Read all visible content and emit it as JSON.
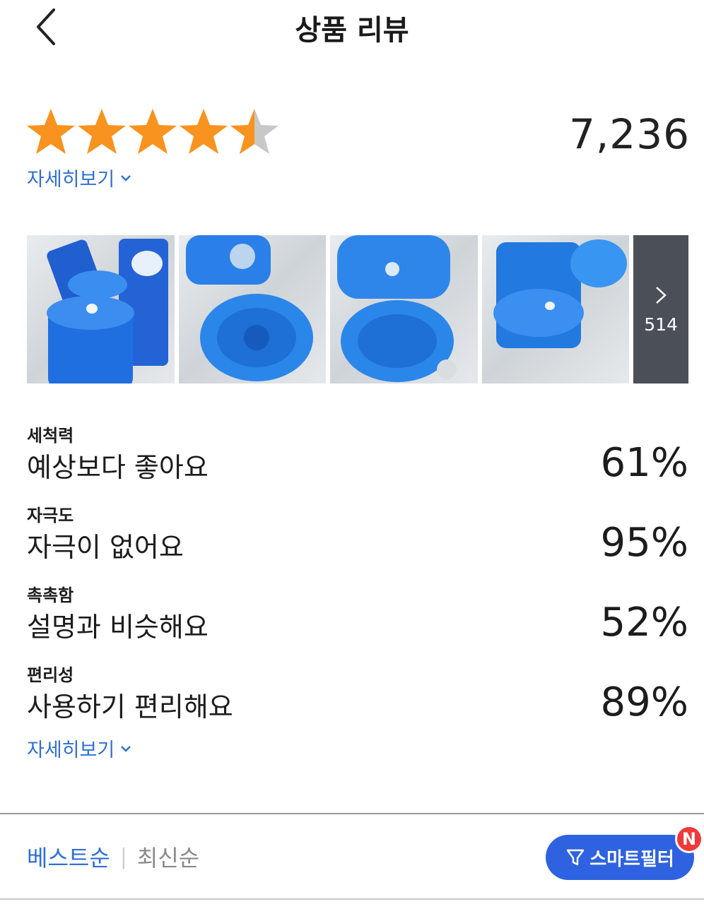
{
  "header": {
    "title": "상품 리뷰"
  },
  "rating": {
    "value": 4.5,
    "max": 5,
    "review_count": "7,236",
    "star_color": "#f7931e",
    "empty_color": "#c8c8c8"
  },
  "detail_link_label": "자세히보기",
  "photos": {
    "more_count": "514"
  },
  "attributes": [
    {
      "category": "세척력",
      "value": "예상보다 좋아요",
      "percent": "61%"
    },
    {
      "category": "자극도",
      "value": "자극이 없어요",
      "percent": "95%"
    },
    {
      "category": "촉촉함",
      "value": "설명과 비슷해요",
      "percent": "52%"
    },
    {
      "category": "편리성",
      "value": "사용하기 편리해요",
      "percent": "89%"
    }
  ],
  "sort": {
    "active": "베스트순",
    "other": "최신순"
  },
  "smart_filter": {
    "label": "스마트필터",
    "badge": "N"
  },
  "colors": {
    "accent": "#2f6fd6",
    "filter_button": "#2e62e0",
    "badge": "#f0383a"
  }
}
